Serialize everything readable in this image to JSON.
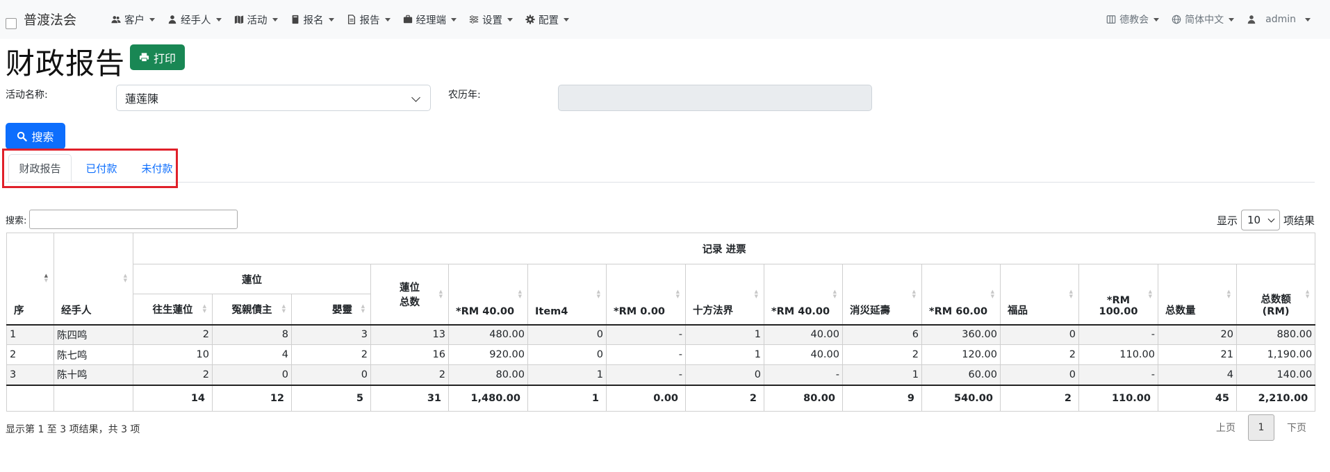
{
  "navbar": {
    "brand": "普渡法会",
    "menu": [
      {
        "label": "客户",
        "icon": "users-icon"
      },
      {
        "label": "经手人",
        "icon": "user-icon"
      },
      {
        "label": "活动",
        "icon": "map-icon"
      },
      {
        "label": "报名",
        "icon": "book-icon"
      },
      {
        "label": "报告",
        "icon": "file-icon"
      },
      {
        "label": "经理端",
        "icon": "briefcase-icon"
      },
      {
        "label": "设置",
        "icon": "sliders-icon"
      },
      {
        "label": "配置",
        "icon": "gear-icon"
      }
    ],
    "right": {
      "org": "德教会",
      "language": "简体中文",
      "user": "admin"
    }
  },
  "page": {
    "title": "财政报告",
    "print_label": "打印",
    "activity_label": "活动名称:",
    "activity_value": "蓮莲陳",
    "lunar_year_label": "农历年:",
    "lunar_year_value": "",
    "search_label": "搜索"
  },
  "tabs": [
    {
      "label": "财政报告",
      "active": true
    },
    {
      "label": "已付款",
      "active": false
    },
    {
      "label": "未付款",
      "active": false
    }
  ],
  "datatable": {
    "search_label": "搜索:",
    "length_prefix": "显示",
    "length_value": "10",
    "length_suffix": "项结果",
    "group_header": "记录 进票",
    "lotus_group": "蓮位",
    "headers": {
      "seq": "序",
      "handler": "经手人",
      "c1": "往生蓮位",
      "c2": "冤親債主",
      "c3": "嬰靈",
      "c4_a": "蓮位",
      "c4_b": "总数",
      "c5": "*RM 40.00",
      "c6": "Item4",
      "c7": "*RM 0.00",
      "c8": "十方法界",
      "c9": "*RM 40.00",
      "c10": "消災延壽",
      "c11": "*RM 60.00",
      "c12": "福品",
      "c13_a": "*RM",
      "c13_b": "100.00",
      "c14": "总数量",
      "c15_a": "总数额",
      "c15_b": "(RM)"
    },
    "rows": [
      [
        "1",
        "陈四鸣",
        "2",
        "8",
        "3",
        "13",
        "480.00",
        "0",
        "-",
        "1",
        "40.00",
        "6",
        "360.00",
        "0",
        "-",
        "20",
        "880.00"
      ],
      [
        "2",
        "陈七鸣",
        "10",
        "4",
        "2",
        "16",
        "920.00",
        "0",
        "-",
        "1",
        "40.00",
        "2",
        "120.00",
        "2",
        "110.00",
        "21",
        "1,190.00"
      ],
      [
        "3",
        "陈十鸣",
        "2",
        "0",
        "0",
        "2",
        "80.00",
        "1",
        "-",
        "0",
        "-",
        "1",
        "60.00",
        "0",
        "-",
        "4",
        "140.00"
      ]
    ],
    "totals": [
      "",
      "",
      "14",
      "12",
      "5",
      "31",
      "1,480.00",
      "1",
      "0.00",
      "2",
      "80.00",
      "9",
      "540.00",
      "2",
      "110.00",
      "45",
      "2,210.00"
    ],
    "info": "显示第 1 至 3 项结果，共 3 项",
    "prev": "上页",
    "page": "1",
    "next": "下页"
  }
}
